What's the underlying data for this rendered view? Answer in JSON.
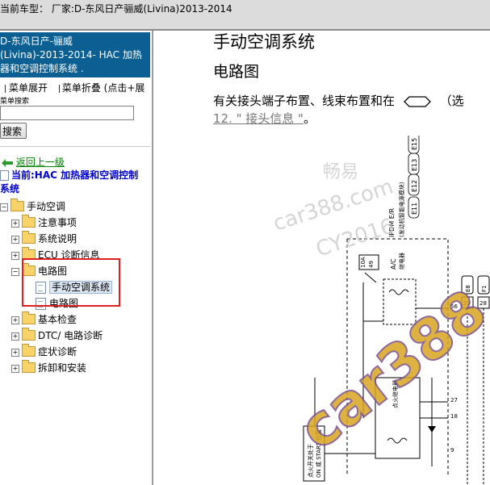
{
  "window": {
    "title": "当前车型：  厂家:D-东风日产骊威(Livina)2013-2014"
  },
  "sidebar": {
    "header_lines": [
      "D-东风日产-骊威",
      "(Livina)-2013-2014- HAC 加热",
      "器和空调控制系统 ."
    ],
    "menu_expand": "菜单展开",
    "menu_collapse": "菜单折叠 (点击+展",
    "search_label": "菜单搜索",
    "search_value": "",
    "search_button": "搜索",
    "back_link": "返回上一级",
    "current_lines": [
      "当前:HAC 加热器和空调控制",
      "系统"
    ],
    "tree": {
      "root": "手动空调",
      "items": [
        "注意事项",
        "系统说明",
        "ECU 诊断信息",
        "电路图"
      ],
      "sub_items": [
        "手动空调系统",
        "电路图"
      ],
      "items_after": [
        "基本检查",
        "DTC/ 电路诊断",
        "症状诊断",
        "拆卸和安装"
      ]
    }
  },
  "content": {
    "heading": "手动空调系统",
    "subheading": "电路图",
    "paragraph_prefix": "有关接头端子布置、线束布置和在",
    "paragraph_suffix": "（选",
    "link_text": "12. \" 接头信息 \"",
    "link_suffix": "。",
    "diagram": {
      "connectors_top": [
        "E11",
        "E12",
        "E13",
        "E15"
      ],
      "module_label_1": "IPDM E/R",
      "module_label_2": "(发动机智能电源模块)",
      "fuse_amp": "10A",
      "fuse_num": "49",
      "relay_1_a": "A/C",
      "relay_1_b": "继电器",
      "relay_2": "点火继电器",
      "pin_1": "56",
      "pin_2": "27",
      "pin_3": "18",
      "pin_4": "9",
      "right_connectors": [
        "E8",
        "F1"
      ],
      "right_pins": [
        "29",
        "28"
      ],
      "ign_label_1": "点火开关处于",
      "ign_label_2": "ON 或 START 位置"
    },
    "watermarks": [
      "畅易",
      "car388.com",
      "CY2016",
      "car388"
    ]
  },
  "colors": {
    "sidebar_header_bg": "#0c5f92",
    "highlight_box": "#e02020",
    "link": "#777777"
  }
}
